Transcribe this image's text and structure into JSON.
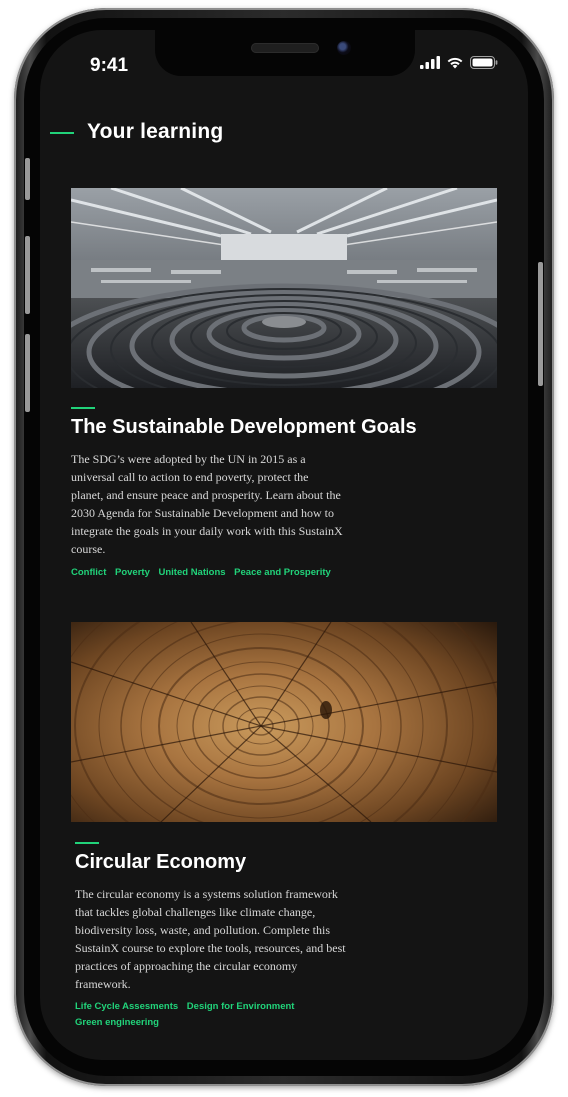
{
  "status_bar": {
    "time": "9:41"
  },
  "header": {
    "title": "Your learning"
  },
  "courses": [
    {
      "title": "The Sustainable Development Goals",
      "description": "The SDG’s were adopted by the UN in 2015 as a universal call to action to end poverty, protect the planet, and ensure peace and prosperity. Learn about the 2030 Agenda for Sustainable Development and how to integrate the goals in your daily work with this SustainX course.",
      "tags": [
        "Conflict",
        "Poverty",
        "United Nations",
        "Peace and Prosperity"
      ],
      "image": "parliament-chamber"
    },
    {
      "title": "Circular Economy",
      "description": "The circular economy is a systems solution framework that tackles global challenges like climate change, biodiversity loss, waste, and pollution. Complete this SustainX course to explore the tools, resources, and best practices of approaching the circular economy framework.",
      "tags": [
        "Life Cycle Assesments",
        "Design for Environment",
        "Green engineering"
      ],
      "image": "tree-rings"
    }
  ],
  "colors": {
    "accent": "#21d37a",
    "background": "#141414",
    "text": "#ffffff"
  }
}
